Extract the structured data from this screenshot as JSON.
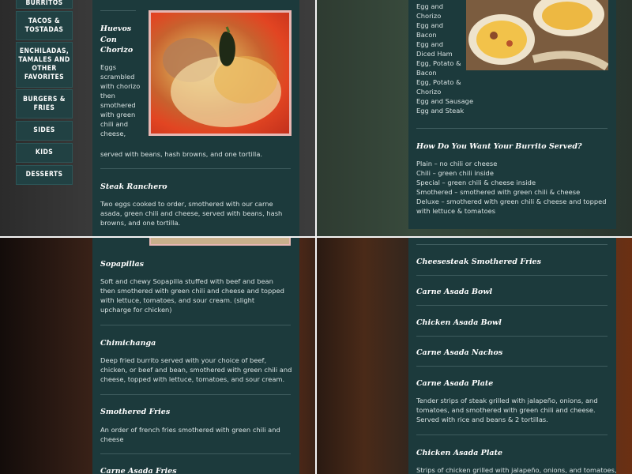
{
  "sidebar": {
    "items": [
      "BURRITOS",
      "TACOS & TOSTADAS",
      "ENCHILADAS, TAMALES AND OTHER FAVORITES",
      "BURGERS & FRIES",
      "SIDES",
      "KIDS",
      "DESSERTS"
    ]
  },
  "q1": {
    "huevos_title": "Huevos Con Chorizo",
    "huevos_desc": "Eggs scrambled with chorizo then smothered with green chili and cheese,",
    "huevos_desc_end": "served with beans, hash browns, and one tortilla.",
    "steak_title": "Steak Ranchero",
    "steak_desc": "Two eggs cooked to order, smothered with our carne asada, green chili and cheese, served with beans, hash browns, and one tortilla."
  },
  "q2": {
    "fillings": [
      "Egg and Chorizo",
      "Egg and Bacon",
      "Egg and Diced Ham",
      "Egg, Potato & Bacon",
      "Egg, Potato & Chorizo",
      "Egg and Sausage",
      "Egg and Steak"
    ],
    "served_title": "How Do You Want Your Burrito Served?",
    "served_options": [
      "Plain – no chili or cheese",
      "Chili – green chili inside",
      "Special – green chili & cheese inside",
      "Smothered – smothered with green chili & cheese",
      "Deluxe – smothered with green chili & cheese and topped with lettuce & tomatoes"
    ]
  },
  "q3": {
    "sopapillas_title": "Sopapillas",
    "sopapillas_desc": "Soft and chewy Sopapilla stuffed with beef and bean then smothered with green chili and cheese and topped with lettuce, tomatoes, and sour cream. (slight upcharge for chicken)",
    "chimi_title": "Chimichanga",
    "chimi_desc": "Deep fried burrito served with your choice of beef, chicken, or beef and bean, smothered with green chili and cheese, topped with lettuce, tomatoes, and sour cream.",
    "fries_title": "Smothered Fries",
    "fries_desc": "An order of french fries smothered with green chili and cheese",
    "asada_fries_title": "Carne Asada Fries"
  },
  "q4": {
    "items": [
      {
        "title": "Cheesesteak Smothered Fries"
      },
      {
        "title": "Carne Asada Bowl"
      },
      {
        "title": "Chicken Asada Bowl"
      },
      {
        "title": "Carne Asada Nachos"
      },
      {
        "title": "Carne Asada Plate",
        "desc": "Tender strips of steak grilled with jalapeño, onions, and tomatoes, and smothered with green chili and cheese. Served with rice and beans & 2 tortillas."
      },
      {
        "title": "Chicken Asada Plate",
        "desc": "Strips of chicken grilled with jalapeño, onions, and tomatoes,"
      }
    ]
  }
}
